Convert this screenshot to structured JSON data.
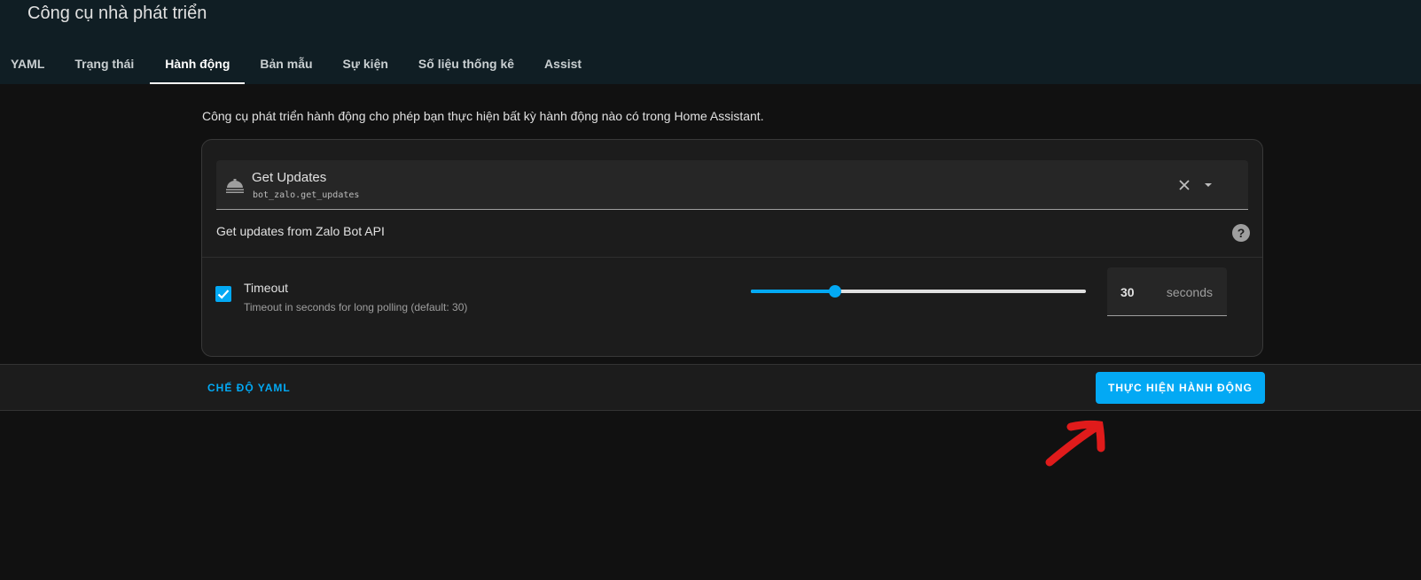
{
  "header": {
    "title": "Công cụ nhà phát triển",
    "tabs": [
      {
        "label": "YAML"
      },
      {
        "label": "Trạng thái"
      },
      {
        "label": "Hành động",
        "active": true
      },
      {
        "label": "Bản mẫu"
      },
      {
        "label": "Sự kiện"
      },
      {
        "label": "Số liệu thống kê"
      },
      {
        "label": "Assist"
      }
    ]
  },
  "main": {
    "description": "Công cụ phát triển hành động cho phép bạn thực hiện bất kỳ hành động nào có trong Home Assistant.",
    "service": {
      "name": "Get Updates",
      "id": "bot_zalo.get_updates",
      "icon": "bell-service-icon",
      "description": "Get updates from Zalo Bot API"
    },
    "timeout": {
      "enabled": true,
      "name": "Timeout",
      "description": "Timeout in seconds for long polling (default: 30)",
      "value": "30",
      "unit": "seconds",
      "slider_fraction": 0.25
    }
  },
  "footer": {
    "yaml_mode_label": "CHẾ ĐỘ YAML",
    "run_label": "THỰC HIỆN HÀNH ĐỘNG"
  },
  "colors": {
    "accent": "#03a9f4",
    "header_bg": "#101e24",
    "page_bg": "#111111",
    "card_bg": "#1c1c1c",
    "annotation": "#e01b1b"
  }
}
